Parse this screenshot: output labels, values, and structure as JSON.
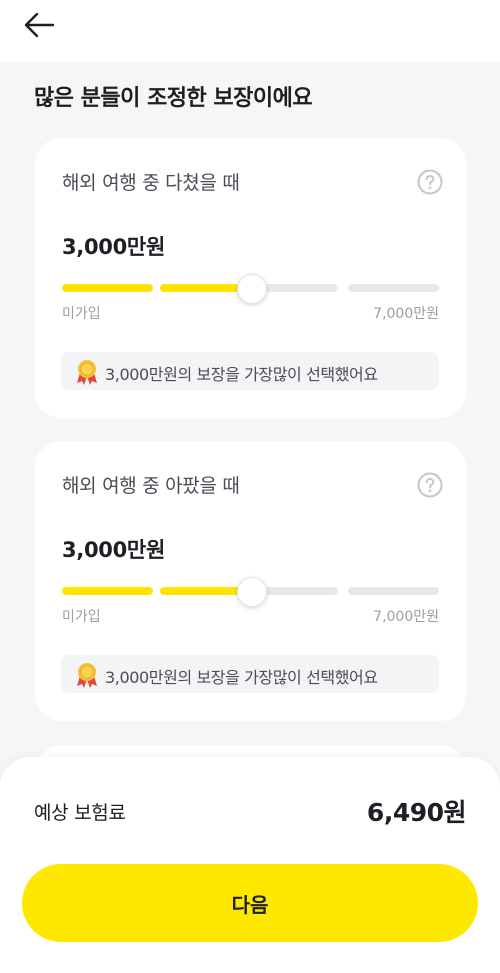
{
  "header": {
    "back_icon": "arrow-left-icon"
  },
  "section_title": "많은 분들이 조정한 보장이에요",
  "coverages": [
    {
      "title": "해외 여행 중 다쳤을 때",
      "amount": "3,000만원",
      "slider": {
        "min_label": "미가입",
        "max_label": "7,000만원",
        "selected_fraction": 0.5
      },
      "notice": "3,000만원의 보장을 가장많이 선택했어요",
      "notice_icon": "medal-icon"
    },
    {
      "title": "해외 여행 중 아팠을 때",
      "amount": "3,000만원",
      "slider": {
        "min_label": "미가입",
        "max_label": "7,000만원",
        "selected_fraction": 0.5
      },
      "notice": "3,000만원의 보장을 가장많이 선택했어요",
      "notice_icon": "medal-icon"
    }
  ],
  "footer": {
    "premium_label": "예상 보험료",
    "premium_value": "6,490원",
    "next_label": "다음"
  },
  "colors": {
    "accent": "#FFE800",
    "slider_fill": "#FFE400",
    "slider_track": "#E6E8EC",
    "background": "#F6F6F7"
  }
}
